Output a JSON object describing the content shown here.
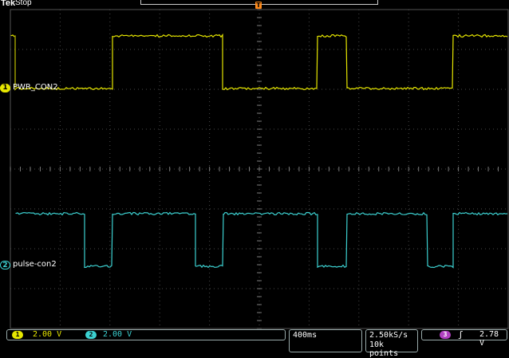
{
  "header": {
    "brand": "Tek",
    "status": "Stop",
    "trigger_marker": "T"
  },
  "channels": [
    {
      "number": "1",
      "name": "PWR_CON2",
      "color": "#e6e600",
      "scale": "2.00 V"
    },
    {
      "number": "2",
      "name": "pulse-con2",
      "color": "#3cd0d0",
      "scale": "2.00 V"
    }
  ],
  "timebase": {
    "time_per_div": "400ms",
    "sample_rate": "2.50kS/s",
    "record_length": "10k points"
  },
  "trigger": {
    "source": "3",
    "source_color": "#b040c0",
    "slope_symbol": "ʃ",
    "level": "2.78 V"
  },
  "waveforms": {
    "ch1_levels": [
      "high",
      "low",
      "high",
      "low",
      "high",
      "low",
      "high"
    ],
    "ch2_levels": [
      "high",
      "low",
      "high",
      "low",
      "high",
      "low",
      "high",
      "low",
      "high"
    ]
  }
}
